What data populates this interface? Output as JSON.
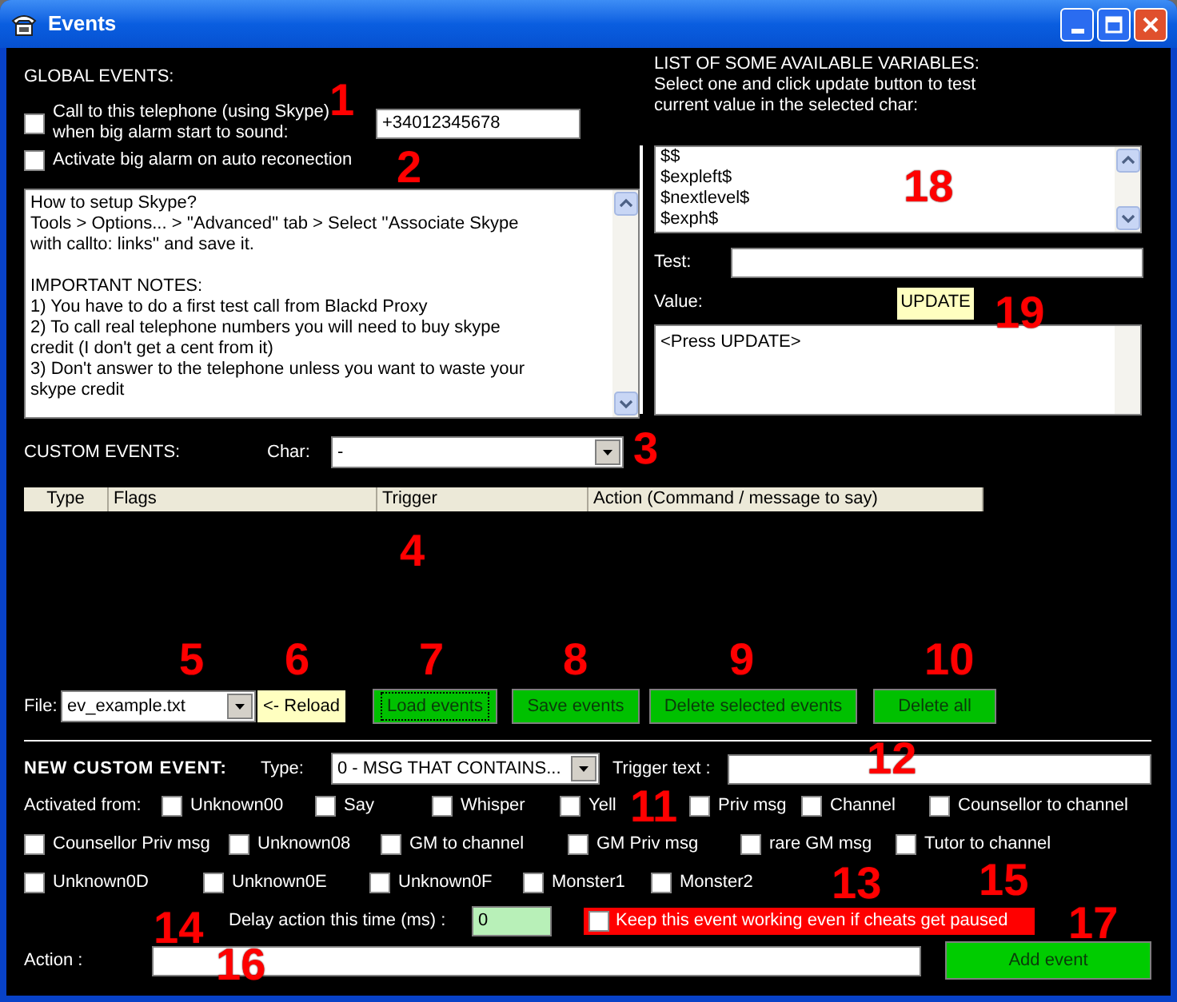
{
  "window": {
    "title": "Events"
  },
  "global_events": {
    "heading": "GLOBAL EVENTS:",
    "options": [
      {
        "label": "Call to this telephone (using Skype)\nwhen big alarm start to sound:",
        "checked": false
      },
      {
        "label": "Activate big alarm on auto reconection",
        "checked": false
      }
    ],
    "phone": "+34012345678",
    "notes": [
      "How to setup Skype?\nTools > Options... > ''Advanced'' tab > Select ''Associate Skype\nwith callto: links'' and save it.",
      "IMPORTANT NOTES:\n1) You have to do a first test call from Blackd Proxy\n2) To call real telephone numbers you will need to buy skype\ncredit (I don't get a cent from it)\n3) Don't answer to the telephone unless you want to waste your\nskype credit"
    ]
  },
  "variables": {
    "heading": "LIST OF SOME AVAILABLE VARIABLES:",
    "hint": "Select one and click update button to test\ncurrent value in the selected char:",
    "items": [
      {
        "label": "$$",
        "selected": false
      },
      {
        "label": "$expleft$",
        "selected": false
      },
      {
        "label": "$nextlevel$",
        "selected": false
      },
      {
        "label": "$exph$",
        "selected": false
      }
    ],
    "test_label": "Test:",
    "value_label": "Value:",
    "update_button": "UPDATE",
    "value_output": "<Press UPDATE>"
  },
  "custom_events": {
    "heading": "CUSTOM EVENTS:",
    "char_label": "Char:",
    "char_value": "-",
    "columns": [
      "Type",
      "Flags",
      "Trigger",
      "Action (Command / message to say)"
    ],
    "file_label": "File:",
    "file_value": "ev_example.txt",
    "buttons": [
      {
        "label": "<- Reload",
        "kind": "yellow",
        "focused": false
      },
      {
        "label": "Load events",
        "kind": "green",
        "focused": true
      },
      {
        "label": "Save events",
        "kind": "green",
        "focused": false
      },
      {
        "label": "Delete selected events",
        "kind": "green",
        "focused": false
      },
      {
        "label": "Delete all",
        "kind": "green",
        "focused": false
      }
    ]
  },
  "new_event": {
    "heading": "NEW CUSTOM EVENT:",
    "type_label": "Type:",
    "type_value": "0 - MSG THAT CONTAINS...",
    "trigger_label": "Trigger text :",
    "activated_label": "Activated from:",
    "sources": [
      {
        "label": "Unknown00",
        "checked": false
      },
      {
        "label": "Say",
        "checked": false
      },
      {
        "label": "Whisper",
        "checked": false
      },
      {
        "label": "Yell",
        "checked": false
      },
      {
        "label": "Priv msg",
        "checked": false
      },
      {
        "label": "Channel",
        "checked": false
      },
      {
        "label": "Counsellor to channel",
        "checked": false
      },
      {
        "label": "Counsellor Priv msg",
        "checked": false
      },
      {
        "label": "Unknown08",
        "checked": false
      },
      {
        "label": "GM to channel",
        "checked": false
      },
      {
        "label": "GM Priv msg",
        "checked": false
      },
      {
        "label": "rare GM msg",
        "checked": false
      },
      {
        "label": "Tutor to channel",
        "checked": false
      },
      {
        "label": "Unknown0D",
        "checked": false
      },
      {
        "label": "Unknown0E",
        "checked": false
      },
      {
        "label": "Unknown0F",
        "checked": false
      },
      {
        "label": "Monster1",
        "checked": false
      },
      {
        "label": "Monster2",
        "checked": false
      }
    ],
    "delay_label": "Delay action this time (ms) :",
    "delay_value": "0",
    "keep": {
      "label": "Keep this event working even if cheats get paused",
      "checked": false
    },
    "action_label": "Action :",
    "add_button": "Add event"
  },
  "annotations": [
    "1",
    "2",
    "3",
    "4",
    "5",
    "6",
    "7",
    "8",
    "9",
    "10",
    "11",
    "12",
    "13",
    "14",
    "15",
    "16",
    "17",
    "18",
    "19"
  ]
}
